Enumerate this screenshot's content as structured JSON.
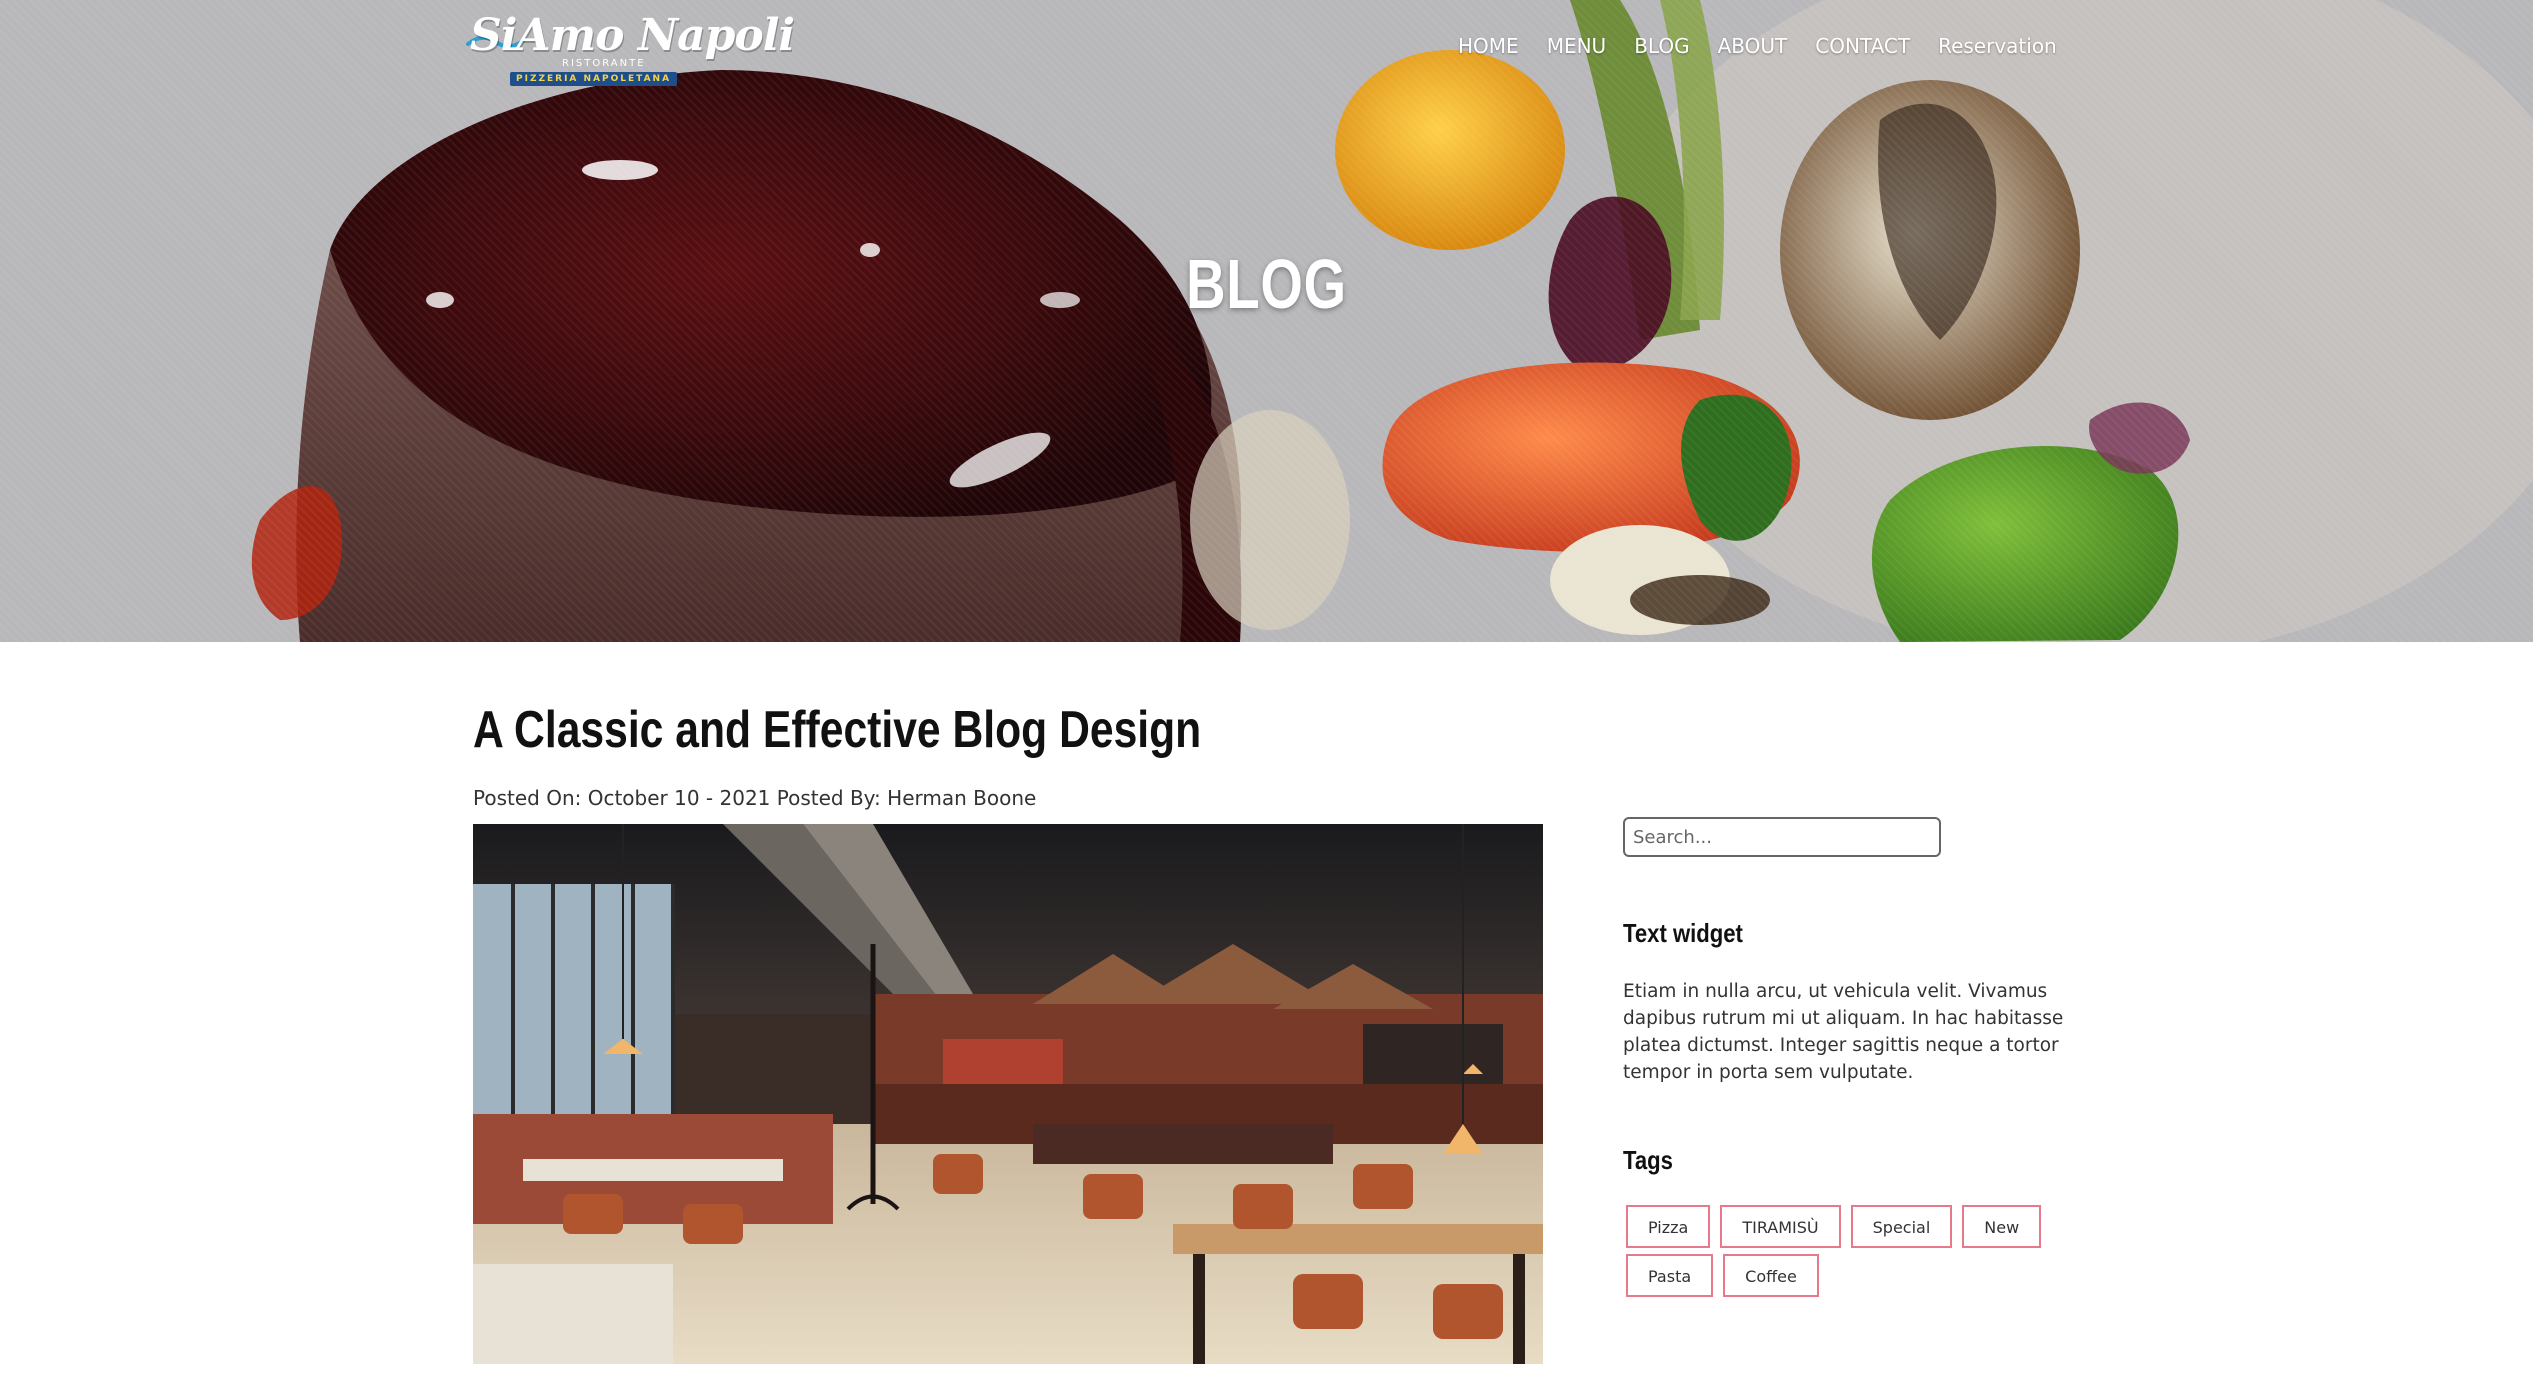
{
  "logo": {
    "main": "SiAmo Napoli",
    "sub1": "RISTORANTE",
    "sub2": "PIZZERIA NAPOLETANA"
  },
  "nav": [
    {
      "label": "HOME"
    },
    {
      "label": "MENU"
    },
    {
      "label": "BLOG"
    },
    {
      "label": "ABOUT"
    },
    {
      "label": "CONTACT"
    },
    {
      "label": "Reservation"
    }
  ],
  "hero": {
    "title": "BLOG"
  },
  "post": {
    "title": "A Classic and Effective Blog Design",
    "meta": "Posted On: October 10 - 2021 Posted By: Herman Boone"
  },
  "sidebar": {
    "search": {
      "placeholder": "Search..."
    },
    "text_widget": {
      "title": "Text widget",
      "body": "Etiam in nulla arcu, ut vehicula velit. Vivamus dapibus rutrum mi ut aliquam. In hac habitasse platea dictumst. Integer sagittis neque a tortor tempor in porta sem vulputate."
    },
    "tags": {
      "title": "Tags",
      "items": [
        "Pizza",
        "TIRAMISÙ",
        "Special",
        "New",
        "Pasta",
        "Coffee"
      ]
    }
  },
  "colors": {
    "tag_border": "#e8798a",
    "hero_bg": "#b3b2b5"
  }
}
